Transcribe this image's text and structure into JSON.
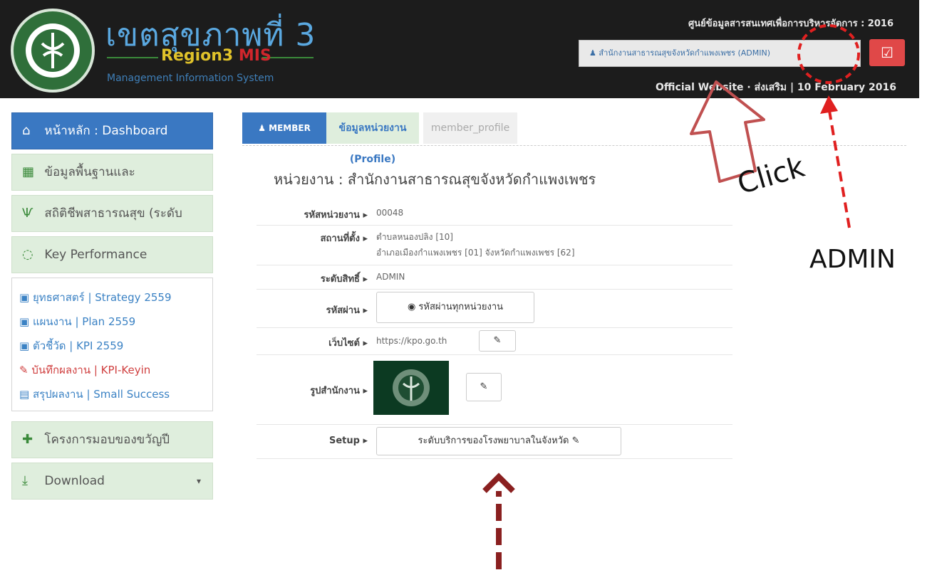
{
  "header": {
    "title": "เขตสุขภาพที่ 3",
    "subtitle_region": "Region3",
    "subtitle_mis": "MIS",
    "tagline": "Management Information System",
    "info_center": "ศูนย์ข้อมูลสารสนเทศเพื่อการบริหารจัดการ : 2016",
    "user_label": "สำนักงานสาธารณสุขจังหวัดกำแพงเพชร (ADMIN)",
    "website_date": "Official Website · ส่งเสริม | 10 February 2016"
  },
  "sidebar": {
    "items": [
      {
        "label": "หน้าหลัก : Dashboard",
        "icon": "home-icon",
        "glyph": "⌂"
      },
      {
        "label": "ข้อมูลพื้นฐานและ",
        "icon": "cubes-icon",
        "glyph": "▦"
      },
      {
        "label": "สถิติชีพสาธารณสุข (ระดับ",
        "icon": "stethoscope-icon",
        "glyph": "Ѱ"
      },
      {
        "label": "Key Performance",
        "icon": "circle-notch-icon",
        "glyph": "◌"
      }
    ],
    "sub_links": [
      {
        "label": "ยุทธศาสตร์ | Strategy 2559",
        "glyph": "▣"
      },
      {
        "label": "แผนงาน | Plan 2559",
        "glyph": "▣"
      },
      {
        "label": "ตัวชี้วัด | KPI 2559",
        "glyph": "▣"
      },
      {
        "label": "บันทึกผลงาน | KPI-Keyin",
        "glyph": "✎"
      },
      {
        "label": "สรุปผลงาน | Small Success",
        "glyph": "▤"
      }
    ],
    "bottom_items": [
      {
        "label": "โครงการมอบของขวัญปี",
        "icon": "gift-icon",
        "glyph": "✚"
      },
      {
        "label": "Download",
        "icon": "download-icon",
        "glyph": "⤓"
      }
    ]
  },
  "tabs": {
    "member": "MEMBER",
    "profile": "ข้อมูลหน่วยงาน (Profile)",
    "member_profile": "member_profile"
  },
  "content": {
    "title": "หน่วยงาน : สำนักงานสาธารณสุขจังหวัดกำแพงเพชร",
    "code_label": "รหัสหน่วยงาน ▸",
    "code_value": "00048",
    "location_label": "สถานที่ตั้ง ▸",
    "location_line1": "ตำบลหนองปลิง [10]",
    "location_line2": "อำเภอเมืองกำแพงเพชร [01] จังหวัดกำแพงเพชร [62]",
    "level_label": "ระดับสิทธิ์ ▸",
    "level_value": "ADMIN",
    "password_label": "รหัสผ่าน ▸",
    "password_button": "◉ รหัสผ่านทุกหน่วยงาน",
    "website_label": "เว็บไซต์ ▸",
    "website_value": "https://kpo.go.th",
    "edit_glyph": "✎",
    "image_label": "รูปสำนักงาน ▸",
    "setup_label": "Setup ▸",
    "setup_button": "ระดับบริการของโรงพยาบาลในจังหวัด ✎"
  },
  "annotations": {
    "click": "Click",
    "admin": "ADMIN"
  },
  "colors": {
    "header_bg": "#1c1c1c",
    "primary_blue": "#3a78c2",
    "sidebar_green": "#dfeedd",
    "danger_red": "#e04848",
    "annotation_red": "#e02020",
    "arrow_outline": "#c05050",
    "arrow_dark": "#8a2020"
  }
}
